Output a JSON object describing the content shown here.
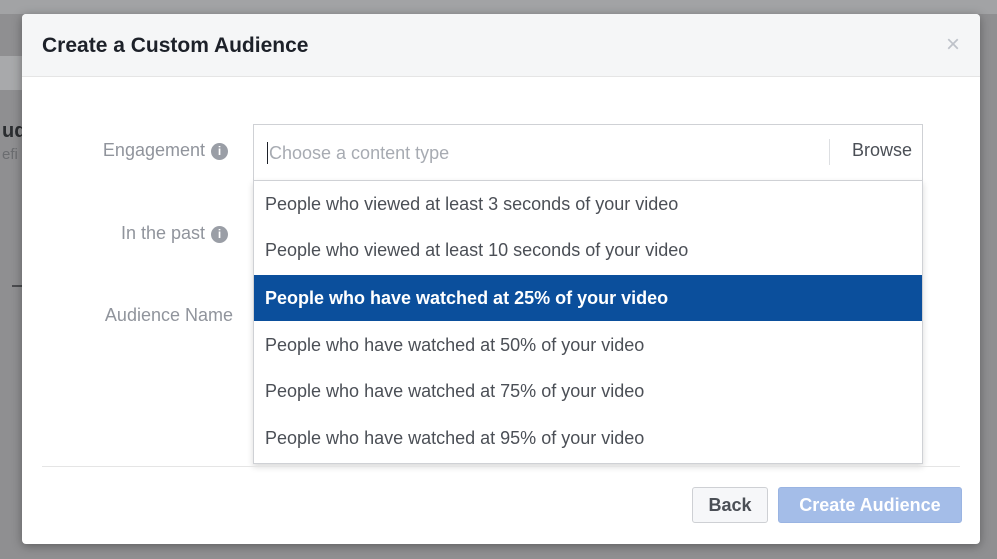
{
  "background": {
    "partial_heading": "ud",
    "partial_subtext": "efi"
  },
  "dialog": {
    "title": "Create a Custom Audience",
    "close_icon": "close-icon"
  },
  "form": {
    "engagement_label": "Engagement",
    "in_the_past_label": "In the past",
    "audience_name_label": "Audience Name",
    "info_icon_glyph": "i",
    "content_type_placeholder": "Choose a content type",
    "browse_label": "Browse"
  },
  "dropdown": {
    "options": [
      "People who viewed at least 3 seconds of your video",
      "People who viewed at least 10 seconds of your video",
      "People who have watched at 25% of your video",
      "People who have watched at 50% of your video",
      "People who have watched at 75% of your video",
      "People who have watched at 95% of your video"
    ],
    "selected_index": 2,
    "selected_color": "#0b4f9c"
  },
  "footer": {
    "back_label": "Back",
    "create_label": "Create Audience"
  }
}
